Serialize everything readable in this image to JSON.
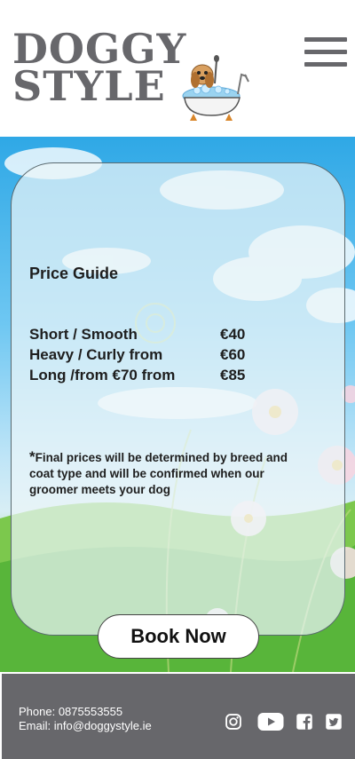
{
  "brand": {
    "line1": "Doggy",
    "line2": "Style"
  },
  "menu": {
    "icon": "hamburger-menu-icon"
  },
  "price_guide": {
    "title": "Price Guide",
    "rows": [
      {
        "label": "Short / Smooth",
        "price": "€40"
      },
      {
        "label": "Heavy / Curly from",
        "price": "€60"
      },
      {
        "label": "Long /from €70  from",
        "price": "€85"
      }
    ],
    "note_star": "*",
    "note": "Final prices will be determined by breed and coat type and will be confirmed when our groomer meets your dog"
  },
  "cta": {
    "book_label": "Book Now"
  },
  "footer": {
    "phone": "Phone: 0875553555",
    "email": "Email: info@doggystyle.ie",
    "social_icons": [
      "instagram-icon",
      "youtube-icon",
      "facebook-icon",
      "twitter-icon"
    ]
  },
  "colors": {
    "brand_gray": "#67676b",
    "text_dark": "#1e1e1e",
    "footer_bg": "#67676b"
  }
}
